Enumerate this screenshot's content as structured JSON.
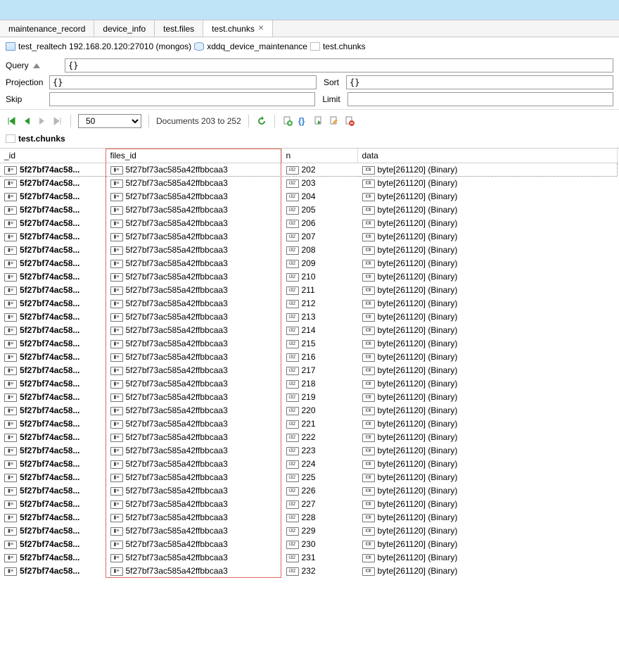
{
  "tabs": [
    {
      "label": "maintenance_record",
      "active": false,
      "closable": false
    },
    {
      "label": "device_info",
      "active": false,
      "closable": false
    },
    {
      "label": "test.files",
      "active": false,
      "closable": false
    },
    {
      "label": "test.chunks",
      "active": true,
      "closable": true
    }
  ],
  "breadcrumb": {
    "connection": "test_realtech 192.168.20.120:27010 (mongos)",
    "database": "xddq_device_maintenance",
    "collection": "test.chunks"
  },
  "query_form": {
    "query_label": "Query",
    "query_value": "{}",
    "projection_label": "Projection",
    "projection_value": "{}",
    "sort_label": "Sort",
    "sort_value": "{}",
    "skip_label": "Skip",
    "skip_value": "",
    "limit_label": "Limit",
    "limit_value": ""
  },
  "toolbar": {
    "page_size": "50",
    "doc_range": "Documents 203 to 252"
  },
  "collection_title": "test.chunks",
  "columns": {
    "id": "_id",
    "files_id": "files_id",
    "n": "n",
    "data": "data"
  },
  "row_template": {
    "id_short": "5f27bf74ac58...",
    "files_id": "5f27bf73ac585a42ffbbcaa3",
    "data": "byte[261120] (Binary)"
  },
  "n_start": 202,
  "n_end": 232
}
